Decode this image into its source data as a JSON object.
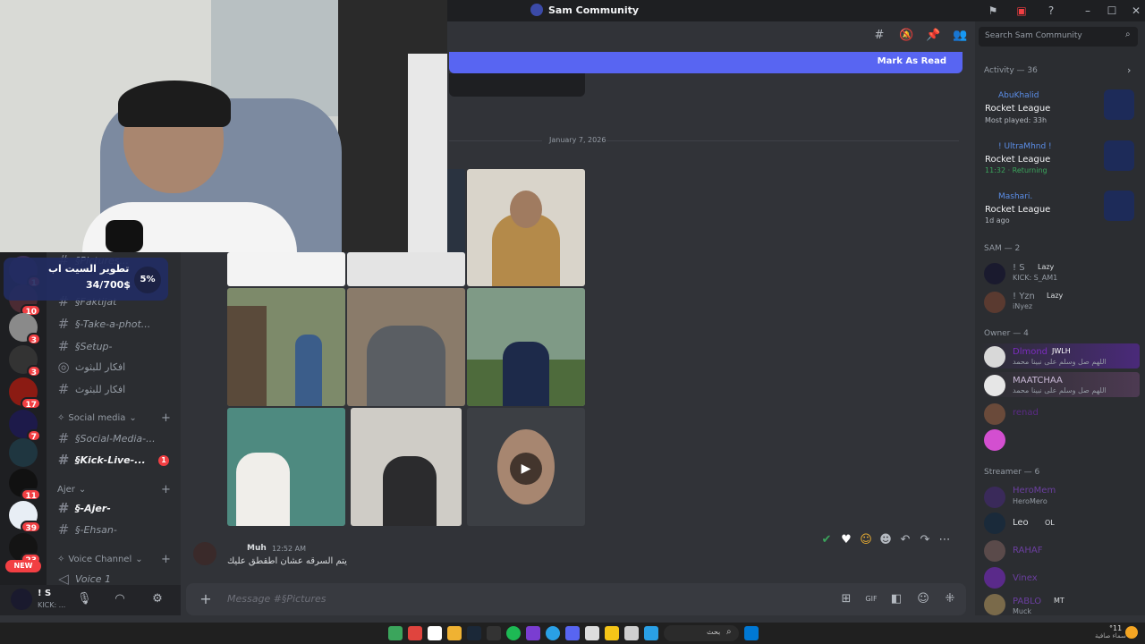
{
  "window": {
    "title": "Sam Community"
  },
  "header": {
    "search_placeholder": "Search Sam Community"
  },
  "banner": {
    "mark_as_read": "Mark As Read"
  },
  "date_divider": "January 7, 2026",
  "overlay": {
    "goal_title": "تطوير السيت اب",
    "goal_amount": "34/700$",
    "goal_percent": "5%"
  },
  "sidebar": {
    "channels": [
      {
        "name": "§Pictures...",
        "bold": false
      },
      {
        "name": "§Faktijat",
        "bold": false
      },
      {
        "name": "§-Take-a-phot...",
        "bold": false
      },
      {
        "name": "§Setup-",
        "bold": false
      },
      {
        "name": "افكار للبثوث",
        "bold": false
      },
      {
        "name": "افكار للبثوث",
        "bold": false
      }
    ],
    "cat_social": "Social media",
    "social_channels": [
      {
        "name": "§Social-Media-...",
        "bold": false
      },
      {
        "name": "§Kick-Live-...",
        "bold": true,
        "badge": "1"
      }
    ],
    "cat_ajer": "Ajer",
    "ajer_channels": [
      {
        "name": "§-Ajer-",
        "bold": true
      },
      {
        "name": "§-Ehsan-",
        "bold": false
      }
    ],
    "cat_voice": "Voice Channel",
    "voice_channel": "Voice 1",
    "user": {
      "name": "! S",
      "status": "KICK: ..."
    }
  },
  "server_badges": [
    "1",
    "10",
    "3",
    "3",
    "17",
    "7",
    "11",
    "39",
    "23"
  ],
  "server_new": "NEW",
  "message": {
    "author": "Muh",
    "time": "12:52 AM",
    "text": "يتم السرقه عشان اطقطق عليك"
  },
  "composer": {
    "placeholder": "Message #§Pictures"
  },
  "members": {
    "activity_label": "Activity — 36",
    "activities": [
      {
        "name": "AbuKhalid",
        "game": "Rocket League",
        "sub": "Most played: 33h"
      },
      {
        "name": "! UltraMhnd !",
        "game": "Rocket League",
        "sub": "11:32 · Returning"
      },
      {
        "name": "Mashari.",
        "game": "Rocket League",
        "sub": "1d ago"
      }
    ],
    "sam_label": "SAM — 2",
    "sam": [
      {
        "name": "! S",
        "tag": "Lazy",
        "sub": "KICK: S_AM1",
        "color": "#949ba4"
      },
      {
        "name": "! Yzn",
        "tag": "Lazy",
        "sub": "iNyez",
        "color": "#949ba4"
      }
    ],
    "owner_label": "Owner — 4",
    "owners": [
      {
        "name": "Dlmond",
        "tag": "JWLH",
        "sub": "اللهم صل وسلم على نبينا محمد",
        "color": "#7b2cbf"
      },
      {
        "name": "MAATCHAA",
        "tag": "",
        "sub": "اللهم صل وسلم على نبينا محمد",
        "color": "#c9b8d6"
      },
      {
        "name": "renad",
        "tag": "",
        "sub": "",
        "color": "#5b2a86"
      },
      {
        "name": "",
        "tag": "",
        "sub": "",
        "color": "#5b2a86"
      }
    ],
    "streamer_label": "Streamer — 6",
    "streamers": [
      {
        "name": "HeroMem",
        "sub": "HeroMero",
        "color": "#6b3fa0"
      },
      {
        "name": "Leo",
        "tag": "OL",
        "sub": "",
        "color": "#dbdee1"
      },
      {
        "name": "RAHAF",
        "sub": "",
        "color": "#6b3fa0"
      },
      {
        "name": "Vinex",
        "sub": "",
        "color": "#6b3fa0"
      },
      {
        "name": "PABLO",
        "tag": "MT",
        "sub": "Muck",
        "color": "#6b3fa0"
      }
    ]
  },
  "taskbar": {
    "search": "بحث",
    "weather": "°11",
    "weather_sub": "سماء صافية"
  }
}
